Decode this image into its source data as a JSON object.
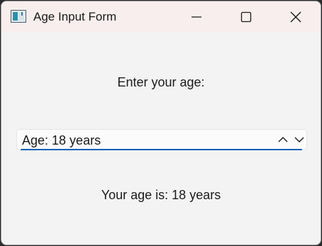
{
  "window": {
    "title": "Age Input Form",
    "controls": {
      "minimize": "minimize",
      "maximize": "maximize",
      "close": "close"
    }
  },
  "form": {
    "prompt": "Enter your age:",
    "age_spinbox": {
      "value_text": "Age: 18 years",
      "value": 18,
      "prefix": "Age: ",
      "suffix": " years"
    },
    "result_text": "Your age is: 18 years"
  },
  "colors": {
    "accent": "#005fb8",
    "background": "#f3f3f3",
    "titlebar": "#f8eeee"
  }
}
